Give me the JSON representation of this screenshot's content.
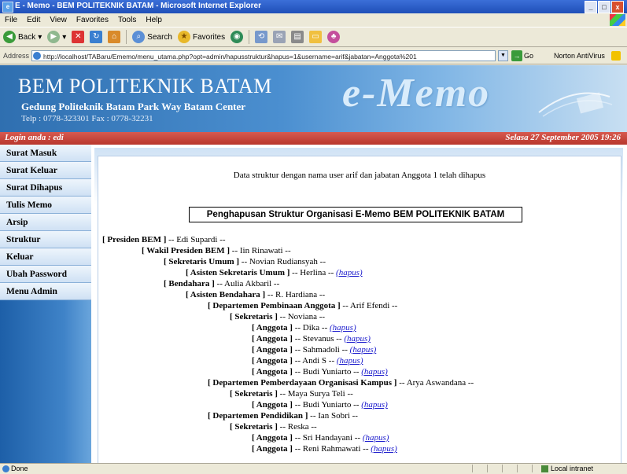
{
  "window": {
    "title": "E - Memo - BEM POLITEKNIK BATAM - Microsoft Internet Explorer",
    "controls": [
      "_",
      "□",
      "x"
    ]
  },
  "menubar": [
    "File",
    "Edit",
    "View",
    "Favorites",
    "Tools",
    "Help"
  ],
  "toolbar": {
    "back_label": "Back",
    "search_label": "Search",
    "favorites_label": "Favorites"
  },
  "addressbar": {
    "label": "Address",
    "url": "http://localhost/TABaru/Ememo/menu_utama.php?opt=admin/hapusstruktur&hapus=1&username=arif&jabatan=Anggota%201",
    "go_label": "Go",
    "norton_label": "Norton AntiVirus"
  },
  "header": {
    "title": "BEM POLITEKNIK BATAM",
    "subtitle": "Gedung Politeknik Batam Park Way Batam Center",
    "phone": "Telp : 0778-323301 Fax : 0778-32231",
    "brand": "e-Memo"
  },
  "strip": {
    "login": "Login anda : edi",
    "datetime": "Selasa 27 September 2005 19:26"
  },
  "sidebar": {
    "items": [
      "Surat Masuk",
      "Surat Keluar",
      "Surat Dihapus",
      "Tulis Memo",
      "Arsip",
      "Struktur",
      "Keluar",
      "Ubah Password",
      "Menu Admin"
    ]
  },
  "content": {
    "message": "Data struktur dengan nama user arif dan jabatan Anggota 1 telah dihapus",
    "box_title": "Penghapusan Struktur Organisasi E-Memo BEM POLITEKNIK BATAM",
    "hapus_label": "(hapus)",
    "tree": [
      {
        "role": "[ Presiden BEM ]",
        "name": "-- Edi Supardi --",
        "hapus": false
      },
      {
        "role": "[ Wakil Presiden BEM ]",
        "name": "-- Iin Rinawati --",
        "hapus": false
      },
      {
        "role": "[ Sekretaris Umum ]",
        "name": "-- Novian Rudiansyah --",
        "hapus": false
      },
      {
        "role": "[ Asisten Sekretaris Umum ]",
        "name": "-- Herlina --",
        "hapus": true
      },
      {
        "role": "[ Bendahara ]",
        "name": "-- Aulia Akbaril --",
        "hapus": false
      },
      {
        "role": "[ Asisten Bendahara ]",
        "name": "-- R. Hardiana --",
        "hapus": false
      },
      {
        "role": "[ Departemen Pembinaan Anggota ]",
        "name": "-- Arif Efendi --",
        "hapus": false
      },
      {
        "role": "[ Sekretaris ]",
        "name": "-- Noviana --",
        "hapus": false
      },
      {
        "role": "[ Anggota ]",
        "name": "-- Dika --",
        "hapus": true
      },
      {
        "role": "[ Anggota ]",
        "name": "-- Stevanus --",
        "hapus": true
      },
      {
        "role": "[ Anggota ]",
        "name": "-- Sahmadoli --",
        "hapus": true
      },
      {
        "role": "[ Anggota ]",
        "name": "-- Andi S --",
        "hapus": true
      },
      {
        "role": "[ Anggota ]",
        "name": "-- Budi Yuniarto --",
        "hapus": true
      },
      {
        "role": "[ Departemen Pemberdayaan Organisasi Kampus ]",
        "name": "-- Arya Aswandana --",
        "hapus": false
      },
      {
        "role": "[ Sekretaris ]",
        "name": "-- Maya Surya Teli --",
        "hapus": false
      },
      {
        "role": "[ Anggota ]",
        "name": "-- Budi Yuniarto --",
        "hapus": true
      },
      {
        "role": "[ Departemen Pendidikan ]",
        "name": "-- Ian Sobri --",
        "hapus": false
      },
      {
        "role": "[ Sekretaris ]",
        "name": "-- Reska --",
        "hapus": false
      },
      {
        "role": "[ Anggota ]",
        "name": "-- Sri Handayani --",
        "hapus": true
      },
      {
        "role": "[ Anggota ]",
        "name": "-- Reni Rahmawati --",
        "hapus": true
      }
    ]
  },
  "statusbar": {
    "left": "Done",
    "zone": "Local intranet"
  }
}
